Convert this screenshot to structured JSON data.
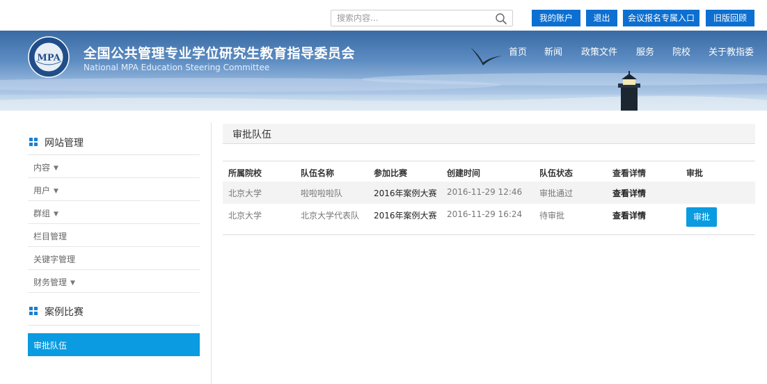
{
  "search": {
    "placeholder": "搜索内容..."
  },
  "top_buttons": [
    {
      "label": "我的账户"
    },
    {
      "label": "退出"
    },
    {
      "label": "会议报名专属入口"
    },
    {
      "label": "旧版回顾"
    }
  ],
  "banner": {
    "title": "全国公共管理专业学位研究生教育指导委员会",
    "subtitle": "National MPA Education Steering Committee",
    "logo_text": "MPA"
  },
  "nav": [
    {
      "label": "首页"
    },
    {
      "label": "新闻"
    },
    {
      "label": "政策文件"
    },
    {
      "label": "服务"
    },
    {
      "label": "院校"
    },
    {
      "label": "关于教指委"
    }
  ],
  "sidebar": {
    "section1_title": "网站管理",
    "items": [
      {
        "label": "内容",
        "caret": "▼"
      },
      {
        "label": "用户",
        "caret": "▼"
      },
      {
        "label": "群组",
        "caret": "▼"
      },
      {
        "label": "栏目管理"
      },
      {
        "label": "关键字管理"
      },
      {
        "label": "财务管理",
        "caret": "▼"
      }
    ],
    "section2_title": "案例比赛",
    "active_item": "审批队伍"
  },
  "main": {
    "title": "审批队伍",
    "columns": [
      "所属院校",
      "队伍名称",
      "参加比赛",
      "创建时间",
      "队伍状态",
      "查看详情",
      "审批"
    ],
    "rows": [
      {
        "school": "北京大学",
        "team": "啦啦啦啦队",
        "contest": "2016年案例大赛",
        "created": "2016-11-29 12:46",
        "status": "审批通过",
        "detail": "查看详情",
        "approve": ""
      },
      {
        "school": "北京大学",
        "team": "北京大学代表队",
        "contest": "2016年案例大赛",
        "created": "2016-11-29 16:24",
        "status": "待审批",
        "detail": "查看详情",
        "approve": "审批"
      }
    ]
  },
  "colors": {
    "top_button": "#0c6fd1",
    "accent": "#0a9be0",
    "banner_top": "#3a6aa3",
    "sidebar_square": "#1a7fd0"
  }
}
